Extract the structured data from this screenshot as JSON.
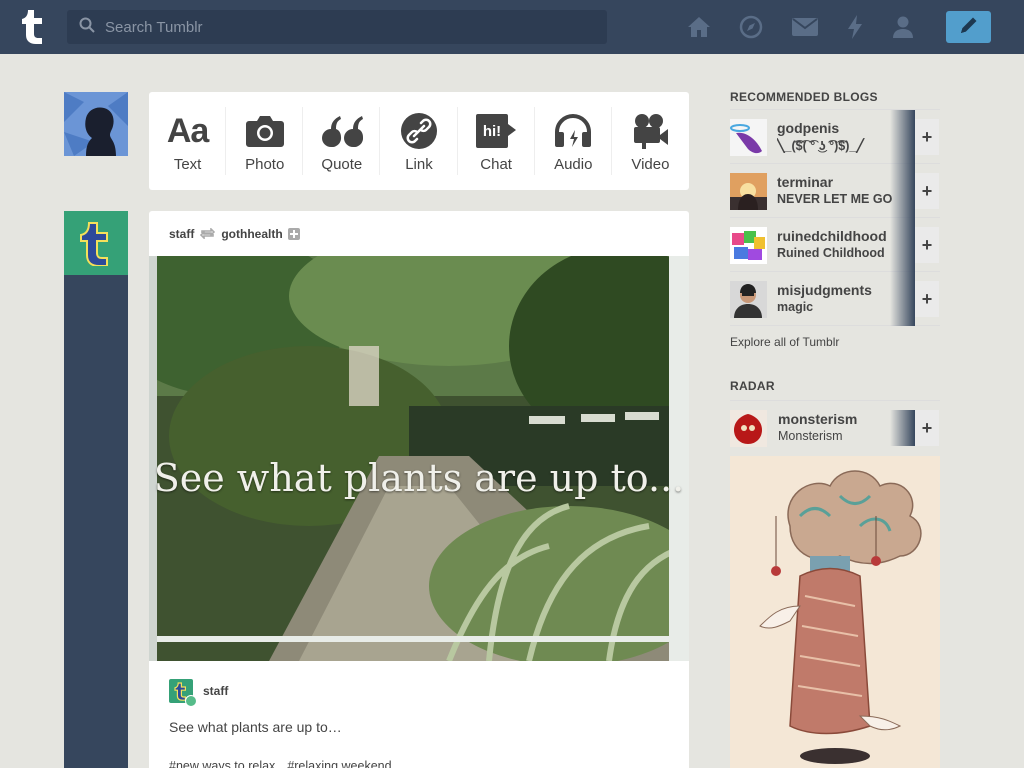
{
  "header": {
    "search_placeholder": "Search Tumblr",
    "nav_icons": [
      "home-icon",
      "explore-icon",
      "mail-icon",
      "activity-icon",
      "account-icon"
    ],
    "compose_icon": "pencil-icon",
    "colors": {
      "header_bg": "#36465d",
      "compose_bg": "#529ecc",
      "page_bg": "#e5e5e0"
    }
  },
  "post_types": [
    {
      "label": "Text",
      "icon": "text-icon"
    },
    {
      "label": "Photo",
      "icon": "camera-icon"
    },
    {
      "label": "Quote",
      "icon": "quote-icon"
    },
    {
      "label": "Link",
      "icon": "link-icon"
    },
    {
      "label": "Chat",
      "icon": "chat-icon",
      "badge": "hi!"
    },
    {
      "label": "Audio",
      "icon": "headphones-icon"
    },
    {
      "label": "Video",
      "icon": "video-camera-icon"
    }
  ],
  "post": {
    "author": "staff",
    "reblogged_from": "gothhealth",
    "image_caption": "See what plants are up to...",
    "reblog_author": "staff",
    "text": "See what plants are up to…",
    "tags": [
      "#new ways to relax",
      "#relaxing weekend"
    ]
  },
  "sidebar": {
    "recommended_title": "RECOMMENDED BLOGS",
    "recommended": [
      {
        "name": "godpenis",
        "subtitle": "╲_(͡$͡( ͡° ͜ʖ ͡°)͡$)_╱"
      },
      {
        "name": "terminar",
        "subtitle": "NEVER LET ME GO"
      },
      {
        "name": "ruinedchildhood",
        "subtitle": "Ruined Childhood"
      },
      {
        "name": "misjudgments",
        "subtitle": "magic"
      }
    ],
    "explore_label": "Explore all of Tumblr",
    "radar_title": "RADAR",
    "radar": {
      "name": "monsterism",
      "subtitle": "Monsterism"
    },
    "follow_label": "+"
  }
}
